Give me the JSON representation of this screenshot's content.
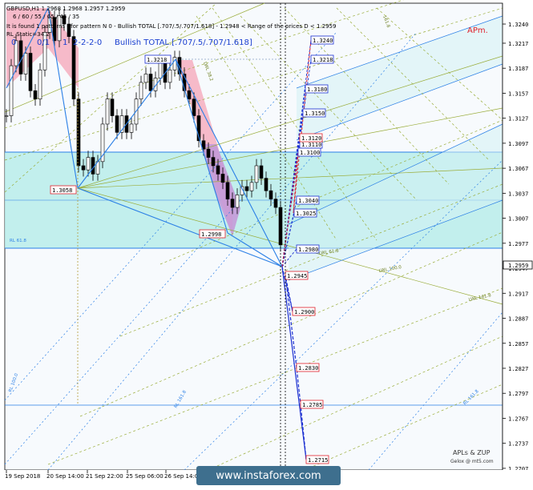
{
  "header": {
    "symbol_line": "GBPUSD,H1  1.2968 1.2968 1.2957 1.2959",
    "settings_line": "6 / 60 / 55 / 65 / 45 / 35",
    "pattern_line": "It is found 1 patterns  - for pattern N 0 - Bullish TOTAL [.707/.5/.707/1.618] - 1.2948 < Range of the prices D < 1.2959",
    "status_line": "RL_Static=34.2",
    "level_0": "0",
    "level_mid": "0/1",
    "level_1": "1",
    "sequence": "2-2-2-0",
    "pattern_name": "Bullish TOTAL [.707/.5/.707/1.618]",
    "brand_top": "APm.",
    "watermark": "www.instaforex.com",
    "credit_title": "APLs & ZUP",
    "credit_sub": "Gelox @ mt5.com"
  },
  "chart_data": {
    "type": "candlestick",
    "symbol": "GBPUSD",
    "timeframe": "H1",
    "ylim": [
      1.2705,
      1.3265
    ],
    "price_axis_ticks": [
      "1.3240",
      "1.3217",
      "1.3187",
      "1.3157",
      "1.3127",
      "1.3097",
      "1.3067",
      "1.3037",
      "1.3007",
      "1.2977",
      "1.2947",
      "1.2917",
      "1.2887",
      "1.2857",
      "1.2827",
      "1.2797",
      "1.2767",
      "1.2737",
      "1.2707"
    ],
    "time_axis_ticks": [
      "19 Sep 2018",
      "20 Sep 14:00",
      "21 Sep 22:00",
      "25 Sep 06:00",
      "26 Sep 14:00"
    ],
    "current_price": "1.2959",
    "target_levels_blue": [
      "1.3240",
      "1.3218",
      "1.3180",
      "1.3150",
      "1.3110",
      "1.3100",
      "1.3040",
      "1.3025",
      "1.2980"
    ],
    "target_levels_red": [
      "1.3120",
      "1.2945",
      "1.2900",
      "1.2830",
      "1.2785",
      "1.2715"
    ],
    "pattern_points": [
      {
        "label": "1.3218",
        "price": 1.3218
      },
      {
        "label": "1.3058",
        "price": 1.3058
      },
      {
        "label": "1.2998",
        "price": 1.2998
      }
    ],
    "line_labels": [
      "LWL 61.8",
      "LWL 100.0",
      "LWL 161.8",
      "RL 61.8",
      "RL 161.8",
      "RL 100.0",
      "RL 161.8",
      "LWL 38.2",
      "161.8"
    ],
    "zones": [
      {
        "name": "buy-zone",
        "from": 1.31,
        "to": 1.298,
        "color": "#b9ecea"
      }
    ]
  },
  "colors": {
    "blue_line": "#2a7fe6",
    "dark_blue": "#1b2fd1",
    "red_line": "#e0202b",
    "olive": "#9aad3a",
    "teal_zone": "#b9ecea",
    "pink_zone": "#f5b3c3",
    "violet_zone": "#c49ad8",
    "axis_bg": "#ffffff"
  }
}
